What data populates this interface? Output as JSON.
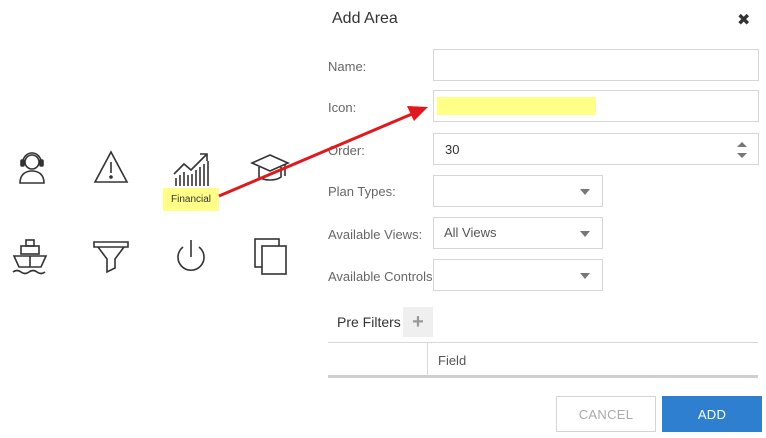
{
  "dialog": {
    "title": "Add Area",
    "close_icon": "close-icon"
  },
  "form": {
    "name_label": "Name:",
    "name_value": "",
    "icon_label": "Icon:",
    "order_label": "Order:",
    "order_value": "30",
    "plan_types_label": "Plan Types:",
    "plan_types_value": "",
    "available_views_label": "Available Views:",
    "available_views_value": "All Views",
    "available_controls_label": "Available Controls:",
    "available_controls_value": ""
  },
  "pre_filters": {
    "label": "Pre Filters",
    "add_icon": "plus-icon",
    "columns": [
      "",
      "Field"
    ]
  },
  "buttons": {
    "cancel": "CANCEL",
    "add": "ADD"
  },
  "icon_palette": {
    "icons": [
      "headset-user-icon",
      "warning-icon",
      "financial-chart-icon",
      "graduation-cap-icon",
      "ship-icon",
      "funnel-icon",
      "power-icon",
      "copy-icon"
    ],
    "tooltip": "Financial"
  },
  "colors": {
    "highlight": "#ffff88",
    "arrow": "#e0191f",
    "primary": "#2f7fd0"
  }
}
